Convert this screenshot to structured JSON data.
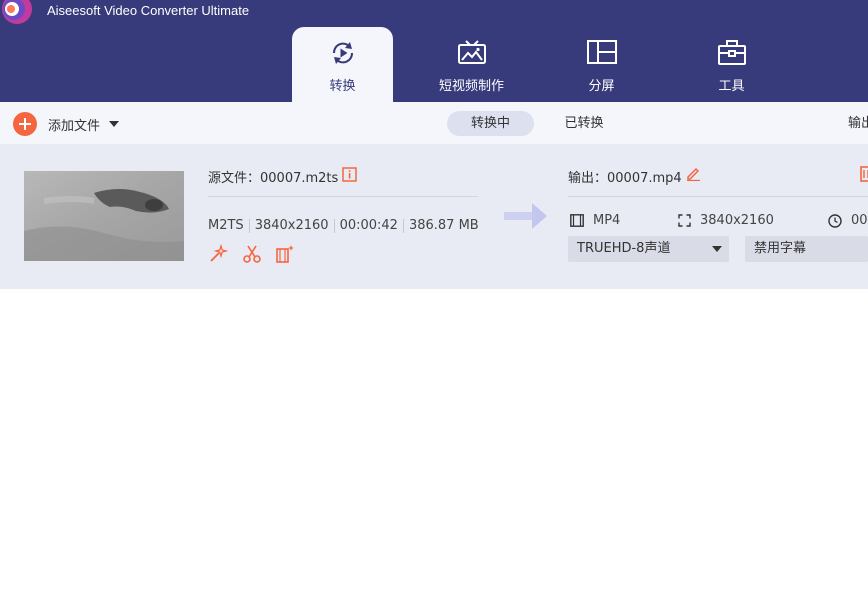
{
  "app": {
    "title": "Aiseesoft Video Converter Ultimate"
  },
  "nav": {
    "tabs": [
      {
        "label": "转换",
        "icon": "convert-icon",
        "active": true
      },
      {
        "label": "短视频制作",
        "icon": "mv-icon",
        "active": false
      },
      {
        "label": "分屏",
        "icon": "collage-icon",
        "active": false
      },
      {
        "label": "工具",
        "icon": "toolbox-icon",
        "active": false
      }
    ]
  },
  "toolbar": {
    "add_files_label": "添加文件",
    "status_tabs": [
      {
        "label": "转换中",
        "active": true
      },
      {
        "label": "已转换",
        "active": false
      }
    ],
    "output_label": "输出"
  },
  "file": {
    "source_label": "源文件：00007.m2ts",
    "format": "M2TS",
    "resolution": "3840x2160",
    "duration": "00:00:42",
    "size": "386.87 MB",
    "output_label": "输出：00007.mp4",
    "output_format": "MP4",
    "output_resolution": "3840x2160",
    "output_duration": "00",
    "audio_track": "TRUEHD-8声道",
    "subtitle": "禁用字幕"
  },
  "colors": {
    "header": "#373a7b",
    "accent": "#f4663f",
    "toolbar_bg": "#f4f6fb",
    "row_bg": "#e9ebf4"
  }
}
